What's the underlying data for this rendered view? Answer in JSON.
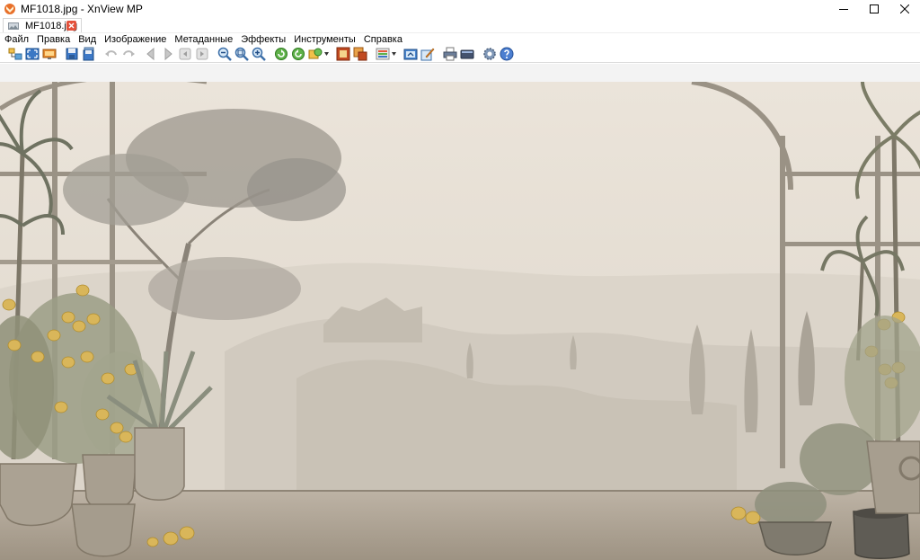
{
  "window": {
    "title": "MF1018.jpg - XnView MP"
  },
  "tabs": [
    {
      "label": "MF1018.jpg"
    }
  ],
  "menu": [
    {
      "label": "Файл"
    },
    {
      "label": "Правка"
    },
    {
      "label": "Вид"
    },
    {
      "label": "Изображение"
    },
    {
      "label": "Метаданные"
    },
    {
      "label": "Эффекты"
    },
    {
      "label": "Инструменты"
    },
    {
      "label": "Справка"
    }
  ],
  "toolbar_icons": [
    "browser-icon",
    "fullscreen-icon",
    "slideshow-icon",
    "save-icon",
    "save-as-icon",
    "undo-icon",
    "redo-icon",
    "previous-icon",
    "next-icon",
    "first-icon",
    "last-icon",
    "zoom-out-icon",
    "zoom-fit-icon",
    "zoom-in-icon",
    "rotate-left-icon",
    "rotate-right-icon",
    "transform-icon",
    "crop-icon",
    "resize-icon",
    "adjust-icon",
    "export-icon",
    "edit-icon",
    "print-icon",
    "scanner-icon",
    "settings-icon",
    "help-icon"
  ],
  "colors": {
    "tab_close": "#e4513b",
    "canvas_bg": "#e7e0d6",
    "sky": "#ebe4da",
    "foliage": "#8f8d84",
    "lemon": "#d9b65a"
  }
}
